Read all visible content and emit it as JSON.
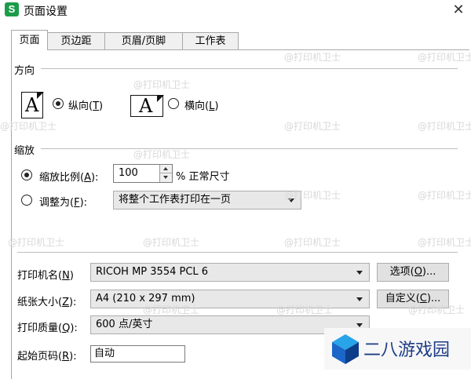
{
  "window": {
    "app_icon_letter": "S",
    "title": "页面设置"
  },
  "tabs": [
    "页面",
    "页边距",
    "页眉/页脚",
    "工作表"
  ],
  "orientation": {
    "section_label": "方向",
    "page_glyph": "A",
    "portrait_label_prefix": "纵向(",
    "portrait_hotkey": "T",
    "portrait_label_suffix": ")",
    "landscape_label_prefix": "横向(",
    "landscape_hotkey": "L",
    "landscape_label_suffix": ")",
    "selected": "portrait"
  },
  "scaling": {
    "section_label": "缩放",
    "scale_label_prefix": "缩放比例(",
    "scale_hotkey": "A",
    "scale_label_suffix": "):",
    "scale_value": "100",
    "scale_suffix": "% 正常尺寸",
    "fit_label_prefix": "调整为(",
    "fit_hotkey": "F",
    "fit_label_suffix": "):",
    "fit_value": "将整个工作表打印在一页",
    "selected": "scale"
  },
  "printer": {
    "printer_label_prefix": "打印机名(",
    "printer_hotkey": "N",
    "printer_label_suffix": ")",
    "printer_value": "RICOH MP 3554 PCL 6",
    "options_button_prefix": "选项(",
    "options_hotkey": "O",
    "options_button_suffix": ")...",
    "paper_label_prefix": "纸张大小(",
    "paper_hotkey": "Z",
    "paper_label_suffix": "):",
    "paper_value": "A4 (210 x 297 mm)",
    "custom_button_prefix": "自定义(",
    "custom_hotkey": "C",
    "custom_button_suffix": ")...",
    "quality_label_prefix": "打印质量(",
    "quality_hotkey": "Q",
    "quality_label_suffix": "):",
    "quality_value": "600 点/英寸",
    "start_label_prefix": "起始页码(",
    "start_hotkey": "R",
    "start_label_suffix": "):",
    "start_value": "自动"
  },
  "watermark": "@打印机卫士",
  "brand_text": "二八游戏园",
  "colors": {
    "app_icon": "#1a9c4a",
    "brand_text": "#1d3c86",
    "brand_icon": "#1a66c9"
  }
}
